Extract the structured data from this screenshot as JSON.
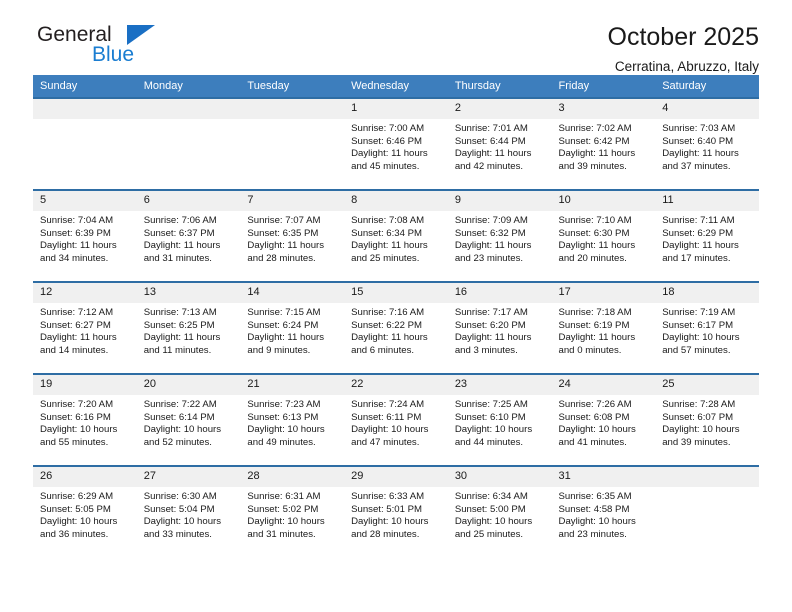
{
  "brand": {
    "name_part1": "General",
    "name_part2": "Blue",
    "triangle_color": "#1a6fc4",
    "blue_color": "#1a7dd1"
  },
  "header": {
    "title": "October 2025",
    "subtitle": "Cerratina, Abruzzo, Italy"
  },
  "theme": {
    "header_bar": "#3d7ebd",
    "row_border": "#2e6da4",
    "daynum_bg": "#f0f0f0",
    "text": "#1a1a1a"
  },
  "weekdays": [
    "Sunday",
    "Monday",
    "Tuesday",
    "Wednesday",
    "Thursday",
    "Friday",
    "Saturday"
  ],
  "weeks": [
    [
      {
        "day": "",
        "empty": true
      },
      {
        "day": "",
        "empty": true
      },
      {
        "day": "",
        "empty": true
      },
      {
        "day": "1",
        "sunrise": "Sunrise: 7:00 AM",
        "sunset": "Sunset: 6:46 PM",
        "daylight": "Daylight: 11 hours and 45 minutes."
      },
      {
        "day": "2",
        "sunrise": "Sunrise: 7:01 AM",
        "sunset": "Sunset: 6:44 PM",
        "daylight": "Daylight: 11 hours and 42 minutes."
      },
      {
        "day": "3",
        "sunrise": "Sunrise: 7:02 AM",
        "sunset": "Sunset: 6:42 PM",
        "daylight": "Daylight: 11 hours and 39 minutes."
      },
      {
        "day": "4",
        "sunrise": "Sunrise: 7:03 AM",
        "sunset": "Sunset: 6:40 PM",
        "daylight": "Daylight: 11 hours and 37 minutes."
      }
    ],
    [
      {
        "day": "5",
        "sunrise": "Sunrise: 7:04 AM",
        "sunset": "Sunset: 6:39 PM",
        "daylight": "Daylight: 11 hours and 34 minutes."
      },
      {
        "day": "6",
        "sunrise": "Sunrise: 7:06 AM",
        "sunset": "Sunset: 6:37 PM",
        "daylight": "Daylight: 11 hours and 31 minutes."
      },
      {
        "day": "7",
        "sunrise": "Sunrise: 7:07 AM",
        "sunset": "Sunset: 6:35 PM",
        "daylight": "Daylight: 11 hours and 28 minutes."
      },
      {
        "day": "8",
        "sunrise": "Sunrise: 7:08 AM",
        "sunset": "Sunset: 6:34 PM",
        "daylight": "Daylight: 11 hours and 25 minutes."
      },
      {
        "day": "9",
        "sunrise": "Sunrise: 7:09 AM",
        "sunset": "Sunset: 6:32 PM",
        "daylight": "Daylight: 11 hours and 23 minutes."
      },
      {
        "day": "10",
        "sunrise": "Sunrise: 7:10 AM",
        "sunset": "Sunset: 6:30 PM",
        "daylight": "Daylight: 11 hours and 20 minutes."
      },
      {
        "day": "11",
        "sunrise": "Sunrise: 7:11 AM",
        "sunset": "Sunset: 6:29 PM",
        "daylight": "Daylight: 11 hours and 17 minutes."
      }
    ],
    [
      {
        "day": "12",
        "sunrise": "Sunrise: 7:12 AM",
        "sunset": "Sunset: 6:27 PM",
        "daylight": "Daylight: 11 hours and 14 minutes."
      },
      {
        "day": "13",
        "sunrise": "Sunrise: 7:13 AM",
        "sunset": "Sunset: 6:25 PM",
        "daylight": "Daylight: 11 hours and 11 minutes."
      },
      {
        "day": "14",
        "sunrise": "Sunrise: 7:15 AM",
        "sunset": "Sunset: 6:24 PM",
        "daylight": "Daylight: 11 hours and 9 minutes."
      },
      {
        "day": "15",
        "sunrise": "Sunrise: 7:16 AM",
        "sunset": "Sunset: 6:22 PM",
        "daylight": "Daylight: 11 hours and 6 minutes."
      },
      {
        "day": "16",
        "sunrise": "Sunrise: 7:17 AM",
        "sunset": "Sunset: 6:20 PM",
        "daylight": "Daylight: 11 hours and 3 minutes."
      },
      {
        "day": "17",
        "sunrise": "Sunrise: 7:18 AM",
        "sunset": "Sunset: 6:19 PM",
        "daylight": "Daylight: 11 hours and 0 minutes."
      },
      {
        "day": "18",
        "sunrise": "Sunrise: 7:19 AM",
        "sunset": "Sunset: 6:17 PM",
        "daylight": "Daylight: 10 hours and 57 minutes."
      }
    ],
    [
      {
        "day": "19",
        "sunrise": "Sunrise: 7:20 AM",
        "sunset": "Sunset: 6:16 PM",
        "daylight": "Daylight: 10 hours and 55 minutes."
      },
      {
        "day": "20",
        "sunrise": "Sunrise: 7:22 AM",
        "sunset": "Sunset: 6:14 PM",
        "daylight": "Daylight: 10 hours and 52 minutes."
      },
      {
        "day": "21",
        "sunrise": "Sunrise: 7:23 AM",
        "sunset": "Sunset: 6:13 PM",
        "daylight": "Daylight: 10 hours and 49 minutes."
      },
      {
        "day": "22",
        "sunrise": "Sunrise: 7:24 AM",
        "sunset": "Sunset: 6:11 PM",
        "daylight": "Daylight: 10 hours and 47 minutes."
      },
      {
        "day": "23",
        "sunrise": "Sunrise: 7:25 AM",
        "sunset": "Sunset: 6:10 PM",
        "daylight": "Daylight: 10 hours and 44 minutes."
      },
      {
        "day": "24",
        "sunrise": "Sunrise: 7:26 AM",
        "sunset": "Sunset: 6:08 PM",
        "daylight": "Daylight: 10 hours and 41 minutes."
      },
      {
        "day": "25",
        "sunrise": "Sunrise: 7:28 AM",
        "sunset": "Sunset: 6:07 PM",
        "daylight": "Daylight: 10 hours and 39 minutes."
      }
    ],
    [
      {
        "day": "26",
        "sunrise": "Sunrise: 6:29 AM",
        "sunset": "Sunset: 5:05 PM",
        "daylight": "Daylight: 10 hours and 36 minutes."
      },
      {
        "day": "27",
        "sunrise": "Sunrise: 6:30 AM",
        "sunset": "Sunset: 5:04 PM",
        "daylight": "Daylight: 10 hours and 33 minutes."
      },
      {
        "day": "28",
        "sunrise": "Sunrise: 6:31 AM",
        "sunset": "Sunset: 5:02 PM",
        "daylight": "Daylight: 10 hours and 31 minutes."
      },
      {
        "day": "29",
        "sunrise": "Sunrise: 6:33 AM",
        "sunset": "Sunset: 5:01 PM",
        "daylight": "Daylight: 10 hours and 28 minutes."
      },
      {
        "day": "30",
        "sunrise": "Sunrise: 6:34 AM",
        "sunset": "Sunset: 5:00 PM",
        "daylight": "Daylight: 10 hours and 25 minutes."
      },
      {
        "day": "31",
        "sunrise": "Sunrise: 6:35 AM",
        "sunset": "Sunset: 4:58 PM",
        "daylight": "Daylight: 10 hours and 23 minutes."
      },
      {
        "day": "",
        "empty": true
      }
    ]
  ]
}
